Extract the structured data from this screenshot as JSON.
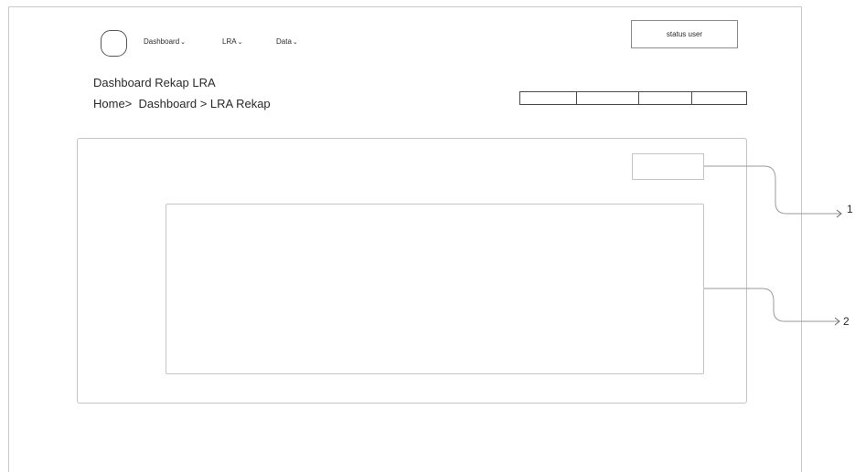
{
  "nav": {
    "items": [
      {
        "label": "Dashboard",
        "chevron": "⌄"
      },
      {
        "label": "LRA",
        "chevron": "⌄"
      },
      {
        "label": "Data",
        "chevron": "⌄"
      }
    ]
  },
  "header": {
    "status_user": "status user"
  },
  "page": {
    "title": "Dashboard Rekap LRA",
    "breadcrumb": "Home>  Dashboard > LRA Rekap"
  },
  "annotations": {
    "callout_1": "1",
    "callout_2": "2"
  },
  "colors": {
    "frame_border": "#c9c9c9",
    "dark_outline": "#4a4a4a",
    "light_outline": "#c4c4c4",
    "text": "#2a2a2a"
  },
  "icons": {
    "logo": "logo-circle-icon",
    "chevron": "chevron-down-icon"
  }
}
